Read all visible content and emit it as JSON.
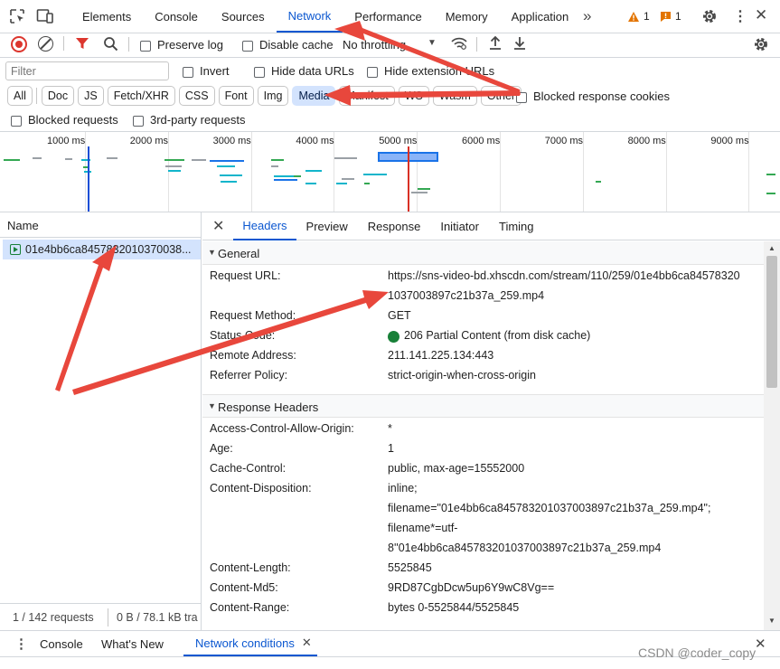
{
  "main_tabs": [
    "Elements",
    "Console",
    "Sources",
    "Network",
    "Performance",
    "Memory",
    "Application"
  ],
  "active_main_tab": "Network",
  "warnings": {
    "warn_count": "1",
    "issue_count": "1"
  },
  "toolbar": {
    "preserve_log": "Preserve log",
    "disable_cache": "Disable cache",
    "throttling": "No throttling"
  },
  "filter": {
    "placeholder": "Filter",
    "invert": "Invert",
    "hide_data_urls": "Hide data URLs",
    "hide_extension_urls": "Hide extension URLs"
  },
  "type_chips": [
    "All",
    "Doc",
    "JS",
    "Fetch/XHR",
    "CSS",
    "Font",
    "Img",
    "Media",
    "Manifest",
    "WS",
    "Wasm",
    "Other"
  ],
  "active_chip": "Media",
  "blocked_response_cookies": "Blocked response cookies",
  "blocked_requests": "Blocked requests",
  "third_party_requests": "3rd-party requests",
  "timeline_ticks": [
    "1000 ms",
    "2000 ms",
    "3000 ms",
    "4000 ms",
    "5000 ms",
    "6000 ms",
    "7000 ms",
    "8000 ms",
    "9000 ms"
  ],
  "name_column": "Name",
  "request_name": "01e4bb6ca8457832010370038...",
  "detail_tabs": [
    "Headers",
    "Preview",
    "Response",
    "Initiator",
    "Timing"
  ],
  "active_detail_tab": "Headers",
  "general": {
    "title": "General",
    "rows": [
      {
        "key": "Request URL:",
        "lines": [
          "https://sns-video-bd.xhscdn.com/stream/110/259/01e4bb6ca84578320",
          "1037003897c21b37a_259.mp4"
        ]
      },
      {
        "key": "Request Method:",
        "lines": [
          "GET"
        ]
      },
      {
        "key": "Status Code:",
        "lines": [
          "206 Partial Content (from disk cache)"
        ],
        "status_dot": "#188038"
      },
      {
        "key": "Remote Address:",
        "lines": [
          "211.141.225.134:443"
        ]
      },
      {
        "key": "Referrer Policy:",
        "lines": [
          "strict-origin-when-cross-origin"
        ]
      }
    ]
  },
  "response_headers": {
    "title": "Response Headers",
    "rows": [
      {
        "key": "Access-Control-Allow-Origin:",
        "lines": [
          "*"
        ]
      },
      {
        "key": "Age:",
        "lines": [
          "1"
        ]
      },
      {
        "key": "Cache-Control:",
        "lines": [
          "public, max-age=15552000"
        ]
      },
      {
        "key": "Content-Disposition:",
        "lines": [
          "inline;",
          "filename=\"01e4bb6ca845783201037003897c21b37a_259.mp4\";",
          "filename*=utf-",
          "8''01e4bb6ca845783201037003897c21b37a_259.mp4"
        ]
      },
      {
        "key": "Content-Length:",
        "lines": [
          "5525845"
        ]
      },
      {
        "key": "Content-Md5:",
        "lines": [
          "9RD87CgbDcw5up6Y9wC8Vg=="
        ]
      },
      {
        "key": "Content-Range:",
        "lines": [
          "bytes 0-5525844/5525845"
        ]
      }
    ]
  },
  "status_bar": {
    "requests": "1 / 142 requests",
    "transferred": "0 B / 78.1 kB tra"
  },
  "drawer_tabs": [
    "Console",
    "What's New",
    "Network conditions"
  ],
  "active_drawer_tab": "Network conditions",
  "watermark": "CSDN @coder_copy",
  "colors": {
    "accent": "#0b57d0",
    "annotation_arrow": "#e8473c",
    "selected_row": "#d3e3fd"
  }
}
